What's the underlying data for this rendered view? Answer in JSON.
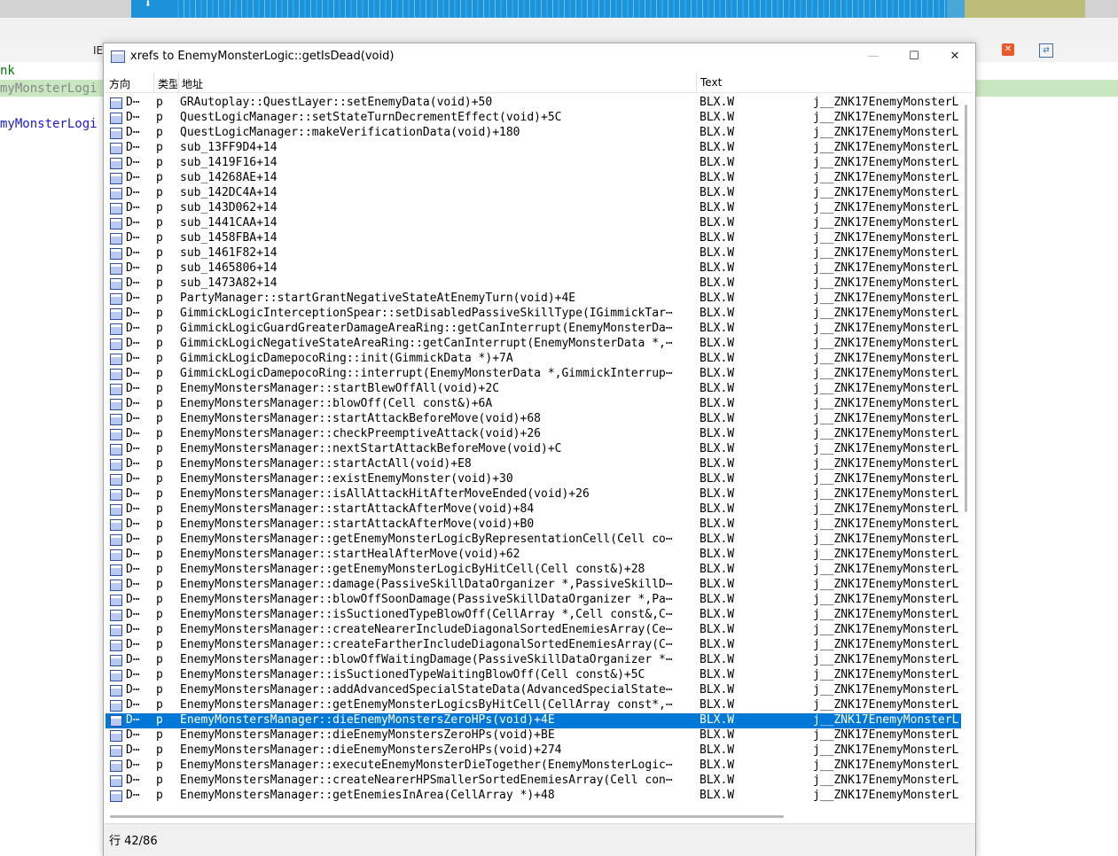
{
  "background": {
    "tab_fragment": "IE",
    "code_lines": [
      "nk",
      "myMonsterLogi",
      "myMonsterLogi"
    ]
  },
  "dialog": {
    "title": "xrefs to EnemyMonsterLogic::getIsDead(void)",
    "controls": {
      "minimize": "—",
      "maximize": "☐",
      "close": "✕"
    },
    "columns": [
      "方向",
      "类型",
      "地址",
      "Text"
    ],
    "status": "行 42/86",
    "rows": [
      {
        "dir": "D⋯",
        "type": "p",
        "addr": "GRAutoplay::QuestLayer::setEnemyData(void)+50",
        "text": "BLX.W",
        "func": "j__ZNK17EnemyMonsterL"
      },
      {
        "dir": "D⋯",
        "type": "p",
        "addr": "QuestLogicManager::setStateTurnDecrementEffect(void)+5C",
        "text": "BLX.W",
        "func": "j__ZNK17EnemyMonsterL"
      },
      {
        "dir": "D⋯",
        "type": "p",
        "addr": "QuestLogicManager::makeVerificationData(void)+180",
        "text": "BLX.W",
        "func": "j__ZNK17EnemyMonsterL"
      },
      {
        "dir": "D⋯",
        "type": "p",
        "addr": "sub_13FF9D4+14",
        "text": "BLX.W",
        "func": "j__ZNK17EnemyMonsterL"
      },
      {
        "dir": "D⋯",
        "type": "p",
        "addr": "sub_1419F16+14",
        "text": "BLX.W",
        "func": "j__ZNK17EnemyMonsterL"
      },
      {
        "dir": "D⋯",
        "type": "p",
        "addr": "sub_14268AE+14",
        "text": "BLX.W",
        "func": "j__ZNK17EnemyMonsterL"
      },
      {
        "dir": "D⋯",
        "type": "p",
        "addr": "sub_142DC4A+14",
        "text": "BLX.W",
        "func": "j__ZNK17EnemyMonsterL"
      },
      {
        "dir": "D⋯",
        "type": "p",
        "addr": "sub_143D062+14",
        "text": "BLX.W",
        "func": "j__ZNK17EnemyMonsterL"
      },
      {
        "dir": "D⋯",
        "type": "p",
        "addr": "sub_1441CAA+14",
        "text": "BLX.W",
        "func": "j__ZNK17EnemyMonsterL"
      },
      {
        "dir": "D⋯",
        "type": "p",
        "addr": "sub_1458FBA+14",
        "text": "BLX.W",
        "func": "j__ZNK17EnemyMonsterL"
      },
      {
        "dir": "D⋯",
        "type": "p",
        "addr": "sub_1461F82+14",
        "text": "BLX.W",
        "func": "j__ZNK17EnemyMonsterL"
      },
      {
        "dir": "D⋯",
        "type": "p",
        "addr": "sub_1465806+14",
        "text": "BLX.W",
        "func": "j__ZNK17EnemyMonsterL"
      },
      {
        "dir": "D⋯",
        "type": "p",
        "addr": "sub_1473A82+14",
        "text": "BLX.W",
        "func": "j__ZNK17EnemyMonsterL"
      },
      {
        "dir": "D⋯",
        "type": "p",
        "addr": "PartyManager::startGrantNegativeStateAtEnemyTurn(void)+4E",
        "text": "BLX.W",
        "func": "j__ZNK17EnemyMonsterL"
      },
      {
        "dir": "D⋯",
        "type": "p",
        "addr": "GimmickLogicInterceptionSpear::setDisabledPassiveSkillType(IGimmickTar⋯",
        "text": "BLX.W",
        "func": "j__ZNK17EnemyMonsterL"
      },
      {
        "dir": "D⋯",
        "type": "p",
        "addr": "GimmickLogicGuardGreaterDamageAreaRing::getCanInterrupt(EnemyMonsterDa⋯",
        "text": "BLX.W",
        "func": "j__ZNK17EnemyMonsterL"
      },
      {
        "dir": "D⋯",
        "type": "p",
        "addr": "GimmickLogicNegativeStateAreaRing::getCanInterrupt(EnemyMonsterData *,⋯",
        "text": "BLX.W",
        "func": "j__ZNK17EnemyMonsterL"
      },
      {
        "dir": "D⋯",
        "type": "p",
        "addr": "GimmickLogicDamepocoRing::init(GimmickData *)+7A",
        "text": "BLX.W",
        "func": "j__ZNK17EnemyMonsterL"
      },
      {
        "dir": "D⋯",
        "type": "p",
        "addr": "GimmickLogicDamepocoRing::interrupt(EnemyMonsterData *,GimmickInterrup⋯",
        "text": "BLX.W",
        "func": "j__ZNK17EnemyMonsterL"
      },
      {
        "dir": "D⋯",
        "type": "p",
        "addr": "EnemyMonstersManager::startBlewOffAll(void)+2C",
        "text": "BLX.W",
        "func": "j__ZNK17EnemyMonsterL"
      },
      {
        "dir": "D⋯",
        "type": "p",
        "addr": "EnemyMonstersManager::blowOff(Cell const&)+6A",
        "text": "BLX.W",
        "func": "j__ZNK17EnemyMonsterL"
      },
      {
        "dir": "D⋯",
        "type": "p",
        "addr": "EnemyMonstersManager::startAttackBeforeMove(void)+68",
        "text": "BLX.W",
        "func": "j__ZNK17EnemyMonsterL"
      },
      {
        "dir": "D⋯",
        "type": "p",
        "addr": "EnemyMonstersManager::checkPreemptiveAttack(void)+26",
        "text": "BLX.W",
        "func": "j__ZNK17EnemyMonsterL"
      },
      {
        "dir": "D⋯",
        "type": "p",
        "addr": "EnemyMonstersManager::nextStartAttackBeforeMove(void)+C",
        "text": "BLX.W",
        "func": "j__ZNK17EnemyMonsterL"
      },
      {
        "dir": "D⋯",
        "type": "p",
        "addr": "EnemyMonstersManager::startActAll(void)+E8",
        "text": "BLX.W",
        "func": "j__ZNK17EnemyMonsterL"
      },
      {
        "dir": "D⋯",
        "type": "p",
        "addr": "EnemyMonstersManager::existEnemyMonster(void)+30",
        "text": "BLX.W",
        "func": "j__ZNK17EnemyMonsterL"
      },
      {
        "dir": "D⋯",
        "type": "p",
        "addr": "EnemyMonstersManager::isAllAttackHitAfterMoveEnded(void)+26",
        "text": "BLX.W",
        "func": "j__ZNK17EnemyMonsterL"
      },
      {
        "dir": "D⋯",
        "type": "p",
        "addr": "EnemyMonstersManager::startAttackAfterMove(void)+84",
        "text": "BLX.W",
        "func": "j__ZNK17EnemyMonsterL"
      },
      {
        "dir": "D⋯",
        "type": "p",
        "addr": "EnemyMonstersManager::startAttackAfterMove(void)+B0",
        "text": "BLX.W",
        "func": "j__ZNK17EnemyMonsterL"
      },
      {
        "dir": "D⋯",
        "type": "p",
        "addr": "EnemyMonstersManager::getEnemyMonsterLogicByRepresentationCell(Cell co⋯",
        "text": "BLX.W",
        "func": "j__ZNK17EnemyMonsterL"
      },
      {
        "dir": "D⋯",
        "type": "p",
        "addr": "EnemyMonstersManager::startHealAfterMove(void)+62",
        "text": "BLX.W",
        "func": "j__ZNK17EnemyMonsterL"
      },
      {
        "dir": "D⋯",
        "type": "p",
        "addr": "EnemyMonstersManager::getEnemyMonsterLogicByHitCell(Cell const&)+28",
        "text": "BLX.W",
        "func": "j__ZNK17EnemyMonsterL"
      },
      {
        "dir": "D⋯",
        "type": "p",
        "addr": "EnemyMonstersManager::damage(PassiveSkillDataOrganizer *,PassiveSkillD⋯",
        "text": "BLX.W",
        "func": "j__ZNK17EnemyMonsterL"
      },
      {
        "dir": "D⋯",
        "type": "p",
        "addr": "EnemyMonstersManager::blowOffSoonDamage(PassiveSkillDataOrganizer *,Pa⋯",
        "text": "BLX.W",
        "func": "j__ZNK17EnemyMonsterL"
      },
      {
        "dir": "D⋯",
        "type": "p",
        "addr": "EnemyMonstersManager::isSuctionedTypeBlowOff(CellArray *,Cell const&,C⋯",
        "text": "BLX.W",
        "func": "j__ZNK17EnemyMonsterL"
      },
      {
        "dir": "D⋯",
        "type": "p",
        "addr": "EnemyMonstersManager::createNearerIncludeDiagonalSortedEnemiesArray(Ce⋯",
        "text": "BLX.W",
        "func": "j__ZNK17EnemyMonsterL"
      },
      {
        "dir": "D⋯",
        "type": "p",
        "addr": "EnemyMonstersManager::createFartherIncludeDiagonalSortedEnemiesArray(C⋯",
        "text": "BLX.W",
        "func": "j__ZNK17EnemyMonsterL"
      },
      {
        "dir": "D⋯",
        "type": "p",
        "addr": "EnemyMonstersManager::blowOffWaitingDamage(PassiveSkillDataOrganizer *⋯",
        "text": "BLX.W",
        "func": "j__ZNK17EnemyMonsterL"
      },
      {
        "dir": "D⋯",
        "type": "p",
        "addr": "EnemyMonstersManager::isSuctionedTypeWaitingBlowOff(Cell const&)+5C",
        "text": "BLX.W",
        "func": "j__ZNK17EnemyMonsterL"
      },
      {
        "dir": "D⋯",
        "type": "p",
        "addr": "EnemyMonstersManager::addAdvancedSpecialStateData(AdvancedSpecialState⋯",
        "text": "BLX.W",
        "func": "j__ZNK17EnemyMonsterL"
      },
      {
        "dir": "D⋯",
        "type": "p",
        "addr": "EnemyMonstersManager::getEnemyMonsterLogicsByHitCell(CellArray const*,⋯",
        "text": "BLX.W",
        "func": "j__ZNK17EnemyMonsterL"
      },
      {
        "dir": "D⋯",
        "type": "p",
        "addr": "EnemyMonstersManager::dieEnemyMonstersZeroHPs(void)+4E",
        "text": "BLX.W",
        "func": "j__ZNK17EnemyMonsterL",
        "selected": true
      },
      {
        "dir": "D⋯",
        "type": "p",
        "addr": "EnemyMonstersManager::dieEnemyMonstersZeroHPs(void)+BE",
        "text": "BLX.W",
        "func": "j__ZNK17EnemyMonsterL"
      },
      {
        "dir": "D⋯",
        "type": "p",
        "addr": "EnemyMonstersManager::dieEnemyMonstersZeroHPs(void)+274",
        "text": "BLX.W",
        "func": "j__ZNK17EnemyMonsterL"
      },
      {
        "dir": "D⋯",
        "type": "p",
        "addr": "EnemyMonstersManager::executeEnemyMonsterDieTogether(EnemyMonsterLogic⋯",
        "text": "BLX.W",
        "func": "j__ZNK17EnemyMonsterL"
      },
      {
        "dir": "D⋯",
        "type": "p",
        "addr": "EnemyMonstersManager::createNearerHPSmallerSortedEnemiesArray(Cell con⋯",
        "text": "BLX.W",
        "func": "j__ZNK17EnemyMonsterL"
      },
      {
        "dir": "D⋯",
        "type": "p",
        "addr": "EnemyMonstersManager::getEnemiesInArea(CellArray *)+48",
        "text": "BLX.W",
        "func": "j__ZNK17EnemyMonsterL"
      }
    ]
  }
}
